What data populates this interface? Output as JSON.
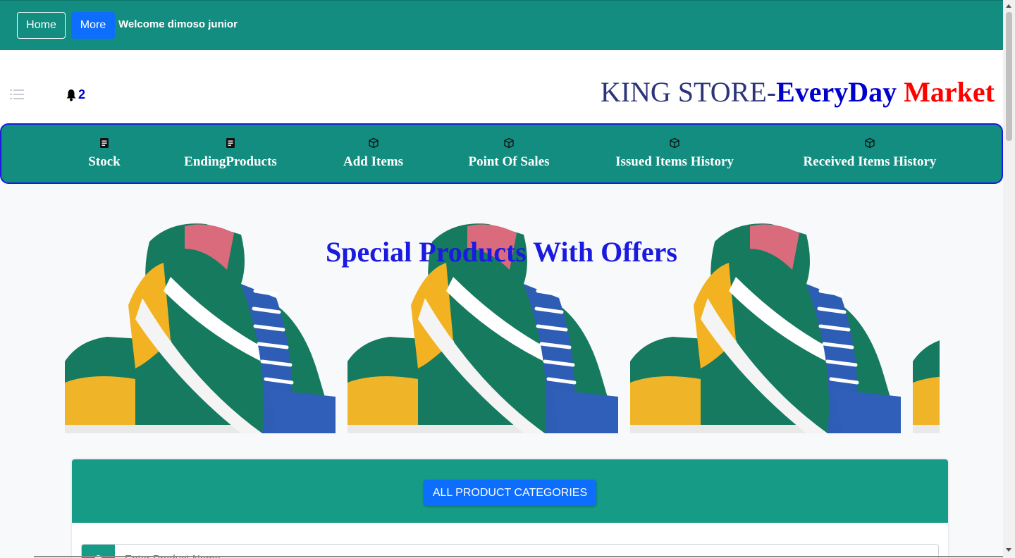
{
  "topbar": {
    "home_label": "Home",
    "more_label": "More",
    "welcome_text": "Welcome dimoso junior",
    "bg_color": "#138d80"
  },
  "header": {
    "notification_count": "2",
    "title_part1": "KING STORE-",
    "title_part2": "EveryDay",
    "title_part3": "Market"
  },
  "menu": {
    "items": [
      {
        "label": "Stock",
        "icon": "document-icon"
      },
      {
        "label": "EndingProducts",
        "icon": "document-icon"
      },
      {
        "label": "Add Items",
        "icon": "box-icon"
      },
      {
        "label": "Point Of Sales",
        "icon": "box-icon"
      },
      {
        "label": "Issued Items History",
        "icon": "box-icon"
      },
      {
        "label": "Received Items History",
        "icon": "box-icon"
      }
    ]
  },
  "banner": {
    "title": "Special Products With Offers",
    "image": "sneaker-shoe"
  },
  "categories": {
    "button_label": "ALL PRODUCT CATEGORIES",
    "search_placeholder": "Enter Product Name"
  },
  "colors": {
    "teal": "#138d80",
    "accent_blue": "#0d6efd",
    "title_blue": "#1a1ae0",
    "market_red": "#ff0000"
  }
}
